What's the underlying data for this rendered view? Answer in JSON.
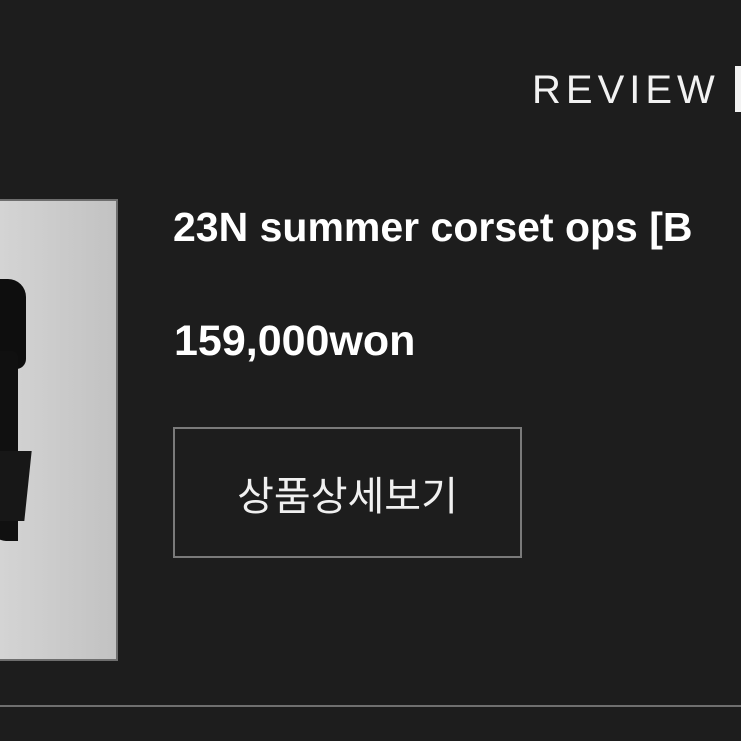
{
  "header": {
    "title": "REVIEW"
  },
  "product": {
    "name": "23N summer corset ops [B",
    "price": "159,000won",
    "detail_button_label": "상품상세보기"
  },
  "colors": {
    "background": "#1d1d1d",
    "text": "#ffffff",
    "button_border": "#7a7a7a",
    "divider": "#6f6f6f"
  }
}
